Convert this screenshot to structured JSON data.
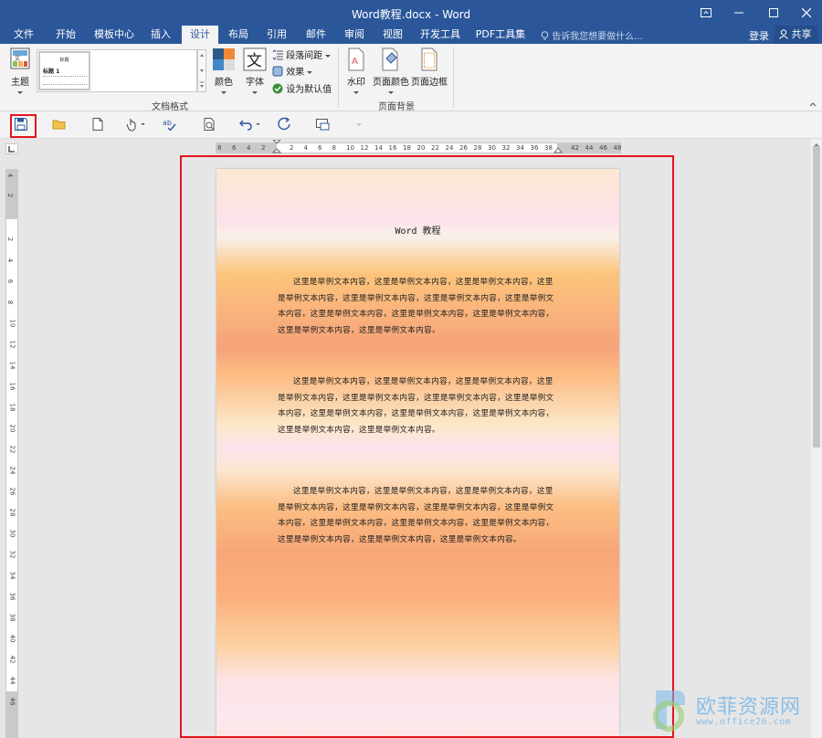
{
  "window": {
    "title": "Word教程.docx - Word"
  },
  "tabs": [
    {
      "label": "文件",
      "active": false
    },
    {
      "label": "开始",
      "active": false
    },
    {
      "label": "模板中心",
      "active": false
    },
    {
      "label": "插入",
      "active": false
    },
    {
      "label": "设计",
      "active": true
    },
    {
      "label": "布局",
      "active": false
    },
    {
      "label": "引用",
      "active": false
    },
    {
      "label": "邮件",
      "active": false
    },
    {
      "label": "审阅",
      "active": false
    },
    {
      "label": "视图",
      "active": false
    },
    {
      "label": "开发工具",
      "active": false
    },
    {
      "label": "PDF工具集",
      "active": false
    }
  ],
  "tellme": {
    "placeholder": "告诉我您想要做什么..."
  },
  "account": {
    "login_label": "登录",
    "share_label": "共享"
  },
  "ribbon": {
    "theme_label": "主题",
    "style_thumb": {
      "title": "标题",
      "heading": "标题 1"
    },
    "colors_label": "颜色",
    "fonts_label": "字体",
    "para_spacing_label": "段落间距",
    "effects_label": "效果",
    "set_default_label": "设为默认值",
    "doc_format_group": "文档格式",
    "watermark_label": "水印",
    "page_color_label": "页面颜色",
    "page_border_label": "页面边框",
    "page_bg_group": "页面背景"
  },
  "ruler": {
    "h_left": [
      "8",
      "6",
      "4",
      "2"
    ],
    "h_main": [
      "2",
      "4",
      "6",
      "8",
      "10",
      "12",
      "14",
      "16",
      "18",
      "20",
      "22",
      "24",
      "26",
      "28",
      "30",
      "32",
      "34",
      "36",
      "38"
    ],
    "h_right": [
      "42",
      "44",
      "46",
      "48"
    ],
    "v_top": [
      "4",
      "2"
    ],
    "v_main": [
      "2",
      "4",
      "6",
      "8",
      "10",
      "12",
      "14",
      "16",
      "18",
      "20",
      "22",
      "24",
      "26",
      "28",
      "30",
      "32",
      "34",
      "36",
      "38",
      "40",
      "42",
      "44"
    ],
    "v_bottom": [
      "46"
    ]
  },
  "document": {
    "title": "Word 教程",
    "paragraphs": [
      "这里是举例文本内容，这里是举例文本内容，这里是举例文本内容，这里是举例文本内容，这里是举例文本内容，这里是举例文本内容，这里是举例文本内容，这里是举例文本内容，这里是举例文本内容，这里是举例文本内容，这里是举例文本内容，这里是举例文本内容。",
      "这里是举例文本内容，这里是举例文本内容，这里是举例文本内容，这里是举例文本内容，这里是举例文本内容，这里是举例文本内容，这里是举例文本内容，这里是举例文本内容，这里是举例文本内容，这里是举例文本内容，这里是举例文本内容，这里是举例文本内容。",
      "这里是举例文本内容，这里是举例文本内容，这里是举例文本内容，这里是举例文本内容，这里是举例文本内容，这里是举例文本内容，这里是举例文本内容，这里是举例文本内容，这里是举例文本内容，这里是举例文本内容，这里是举例文本内容，这里是举例文本内容，这里是举例文本内容。"
    ]
  },
  "watermark": {
    "brand": "欧菲资源网",
    "url": "www.office26.com"
  },
  "colors": {
    "accent": "#2b579a",
    "highlight": "#e0171f"
  }
}
